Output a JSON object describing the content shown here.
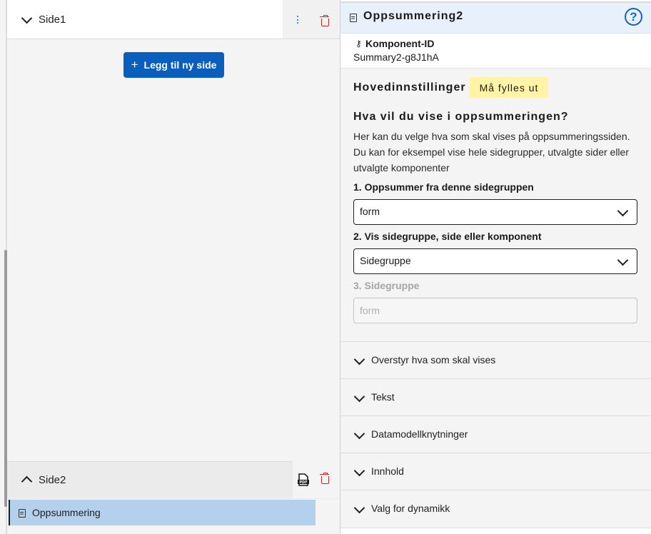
{
  "left": {
    "page1": {
      "label": "Side1"
    },
    "add_page_label": "Legg til ny side",
    "page2": {
      "label": "Side2",
      "pdf_label": "PDF"
    },
    "summary_item": {
      "label": "Oppsummering"
    }
  },
  "right": {
    "component_title": "Oppsummering2",
    "help_symbol": "?",
    "component_id_label": "Komponent-ID",
    "component_id_value": "Summary2-g8J1hA",
    "main_settings": {
      "heading": "Hovedinnstillinger",
      "required_badge": "Må fylles ut",
      "question": "Hva vil du vise i oppsummeringen?",
      "description_lines": [
        "Her kan du velge hva som skal vises på oppsummeringssiden.",
        "Du kan for eksempel vise hele sidegrupper, utvalgte sider eller",
        "utvalgte komponenter"
      ],
      "field1_label": "1. Oppsummer fra denne sidegruppen",
      "field1_value": "form",
      "field2_label": "2. Vis sidegruppe, side eller komponent",
      "field2_value": "Sidegruppe",
      "field3_label": "3. Sidegruppe",
      "field3_placeholder": "form"
    },
    "accordions": [
      {
        "label": "Overstyr hva som skal vises"
      },
      {
        "label": "Tekst"
      },
      {
        "label": "Datamodellknytninger"
      },
      {
        "label": "Innhold"
      },
      {
        "label": "Valg for dynamikk"
      }
    ]
  },
  "colors": {
    "primary": "#0a5fbd",
    "danger": "#c62828",
    "selected": "#b3d0ec",
    "badge": "#fff3a8"
  }
}
